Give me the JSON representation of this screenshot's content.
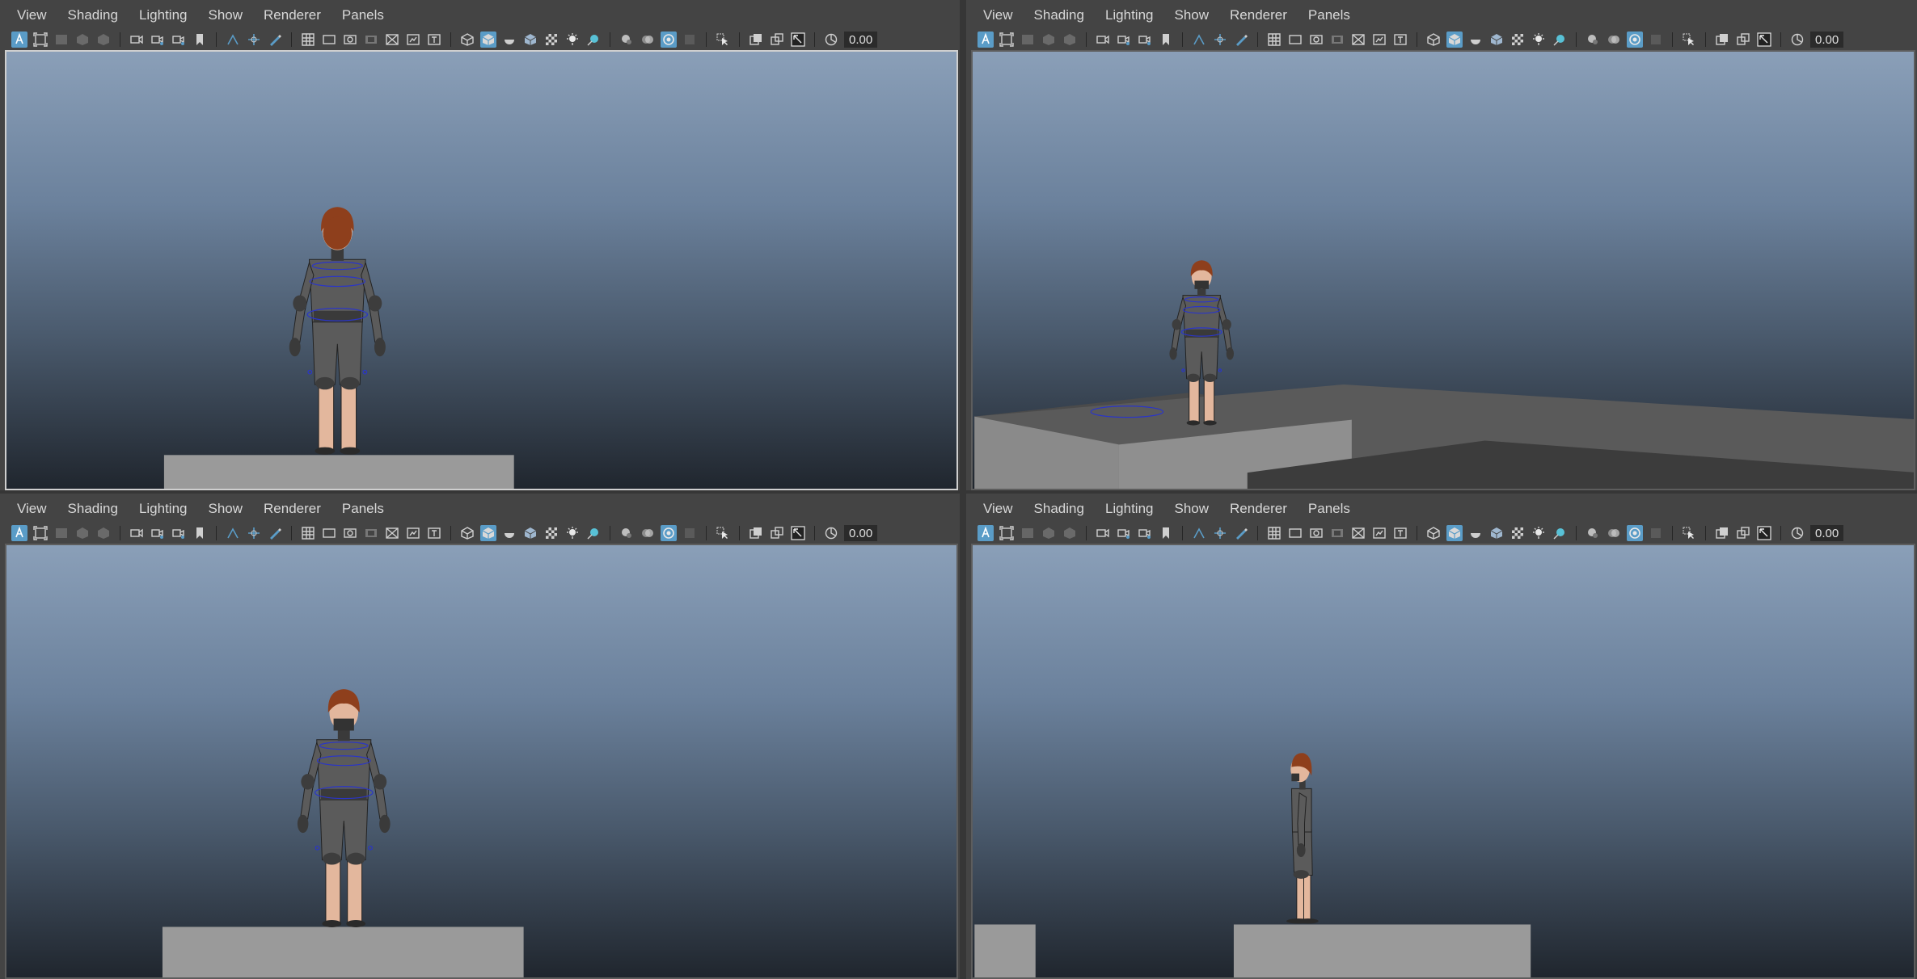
{
  "menu": [
    "View",
    "Shading",
    "Lighting",
    "Show",
    "Renderer",
    "Panels"
  ],
  "toolbar": {
    "exposure_value": "0.00",
    "icons": [
      "select-camera-icon",
      "camera-attributes-icon",
      "bookmark-icon",
      "image-plane-icon",
      "grid-icon",
      "film-gate-icon",
      "resolution-gate-icon",
      "gate-mask-icon",
      "field-chart-icon",
      "safe-action-icon",
      "safe-title-icon",
      "wireframe-icon",
      "smooth-shade-icon",
      "shaded-wireframe-icon",
      "textured-icon",
      "lights-icon",
      "shadows-icon",
      "ambient-occlusion-icon",
      "motion-blur-icon",
      "anti-alias-icon",
      "isolate-select-icon",
      "xray-icon",
      "xray-joints-icon",
      "exposure-icon"
    ]
  },
  "panels": [
    {
      "id": "persp-front",
      "active": true
    },
    {
      "id": "persp-angled",
      "active": false
    },
    {
      "id": "front-view",
      "active": false
    },
    {
      "id": "side-view",
      "active": false
    }
  ],
  "colors": {
    "panel_bg": "#444444",
    "accent": "#5a9cc7",
    "skin": "#e3b79d",
    "suit": "#5b5b5b",
    "hair": "#8e3f1c",
    "rig_curve": "#2a35c8",
    "ground": "#9a9a9a"
  }
}
